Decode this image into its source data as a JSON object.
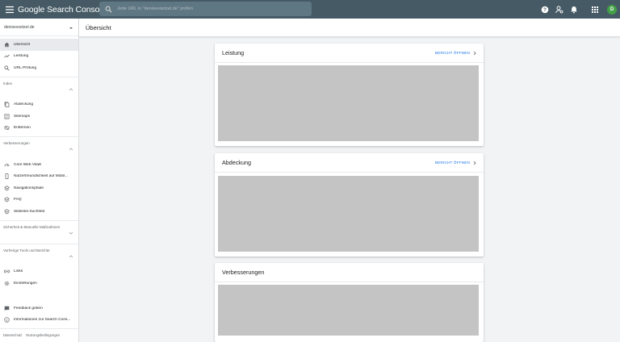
{
  "app": {
    "title": "Google Search Console",
    "search_placeholder": "Jede URL in \"denisevoetzel.de\" prüfen",
    "avatar_letter": "D",
    "header_color": "#455a64"
  },
  "sidebar": {
    "property": "denisevoetzel.de",
    "top_items": [
      {
        "label": "Übersicht",
        "icon": "home-icon"
      },
      {
        "label": "Leistung",
        "icon": "trending-up-icon"
      },
      {
        "label": "URL-Prüfung",
        "icon": "search-icon"
      }
    ],
    "sections": [
      {
        "label": "Index",
        "items": [
          {
            "label": "Abdeckung",
            "icon": "file-copy-icon"
          },
          {
            "label": "Sitemaps",
            "icon": "sitemap-icon"
          },
          {
            "label": "Entfernen",
            "icon": "eye-off-icon"
          }
        ]
      },
      {
        "label": "Verbesserungen",
        "items": [
          {
            "label": "Core Web Vitals",
            "icon": "gauge-icon"
          },
          {
            "label": "Nutzerfreundlichkeit auf Mobil...",
            "icon": "mobile-icon"
          },
          {
            "label": "Navigationspfade",
            "icon": "layers-icon"
          },
          {
            "label": "FAQ",
            "icon": "layers-icon"
          },
          {
            "label": "Sitelinks-Suchfeld",
            "icon": "layers-icon"
          }
        ]
      },
      {
        "label": "Sicherheit & Manuelle Maßnahmen",
        "items": []
      },
      {
        "label": "Vorherige Tools und Berichte",
        "items": [
          {
            "label": "Links",
            "icon": "link-icon"
          },
          {
            "label": "Einstellungen",
            "icon": "gear-icon"
          }
        ]
      }
    ],
    "bottom_items": [
      {
        "label": "Feedback geben",
        "icon": "feedback-icon"
      },
      {
        "label": "Informationen zur Search Cons...",
        "icon": "info-icon"
      }
    ],
    "footer_links": [
      "Datenschutz",
      "Nutzungsbedingungen"
    ]
  },
  "main": {
    "page_title": "Übersicht",
    "cards": [
      {
        "title": "Leistung",
        "link": "BERICHT ÖFFNEN"
      },
      {
        "title": "Abdeckung",
        "link": "BERICHT ÖFFNEN"
      },
      {
        "title": "Verbesserungen"
      }
    ]
  }
}
